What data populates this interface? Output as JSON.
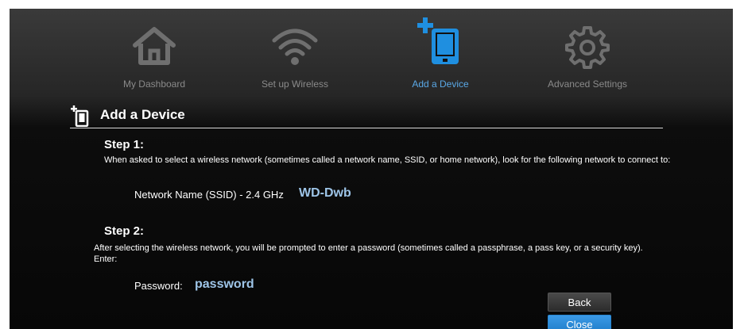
{
  "nav": {
    "items": [
      {
        "label": "My Dashboard",
        "icon": "home-icon",
        "active": false
      },
      {
        "label": "Set up Wireless",
        "icon": "wifi-icon",
        "active": false
      },
      {
        "label": "Add a Device",
        "icon": "tablet-add-icon",
        "active": true
      },
      {
        "label": "Advanced Settings",
        "icon": "gear-icon",
        "active": false
      }
    ]
  },
  "section": {
    "title": "Add a Device",
    "icon": "add-device-icon"
  },
  "step1": {
    "title": "Step 1:",
    "text": "When asked to select a wireless network (sometimes called a network name, SSID, or home network), look for the following network to connect to:",
    "network_label": "Network Name (SSID) - 2.4 GHz",
    "network_value": "WD-Dwb"
  },
  "step2": {
    "title": "Step 2:",
    "text": "After selecting the wireless network, you will be prompted to enter a password (sometimes called a passphrase, a pass key, or a security key). Enter:",
    "password_label": "Password:",
    "password_value": "password"
  },
  "buttons": {
    "back": "Back",
    "close": "Close"
  },
  "colors": {
    "accent": "#1f8fe0",
    "active_label": "#5aa8e6",
    "value_text": "#9ec5e8",
    "inactive_icon": "#6f6f6f"
  }
}
